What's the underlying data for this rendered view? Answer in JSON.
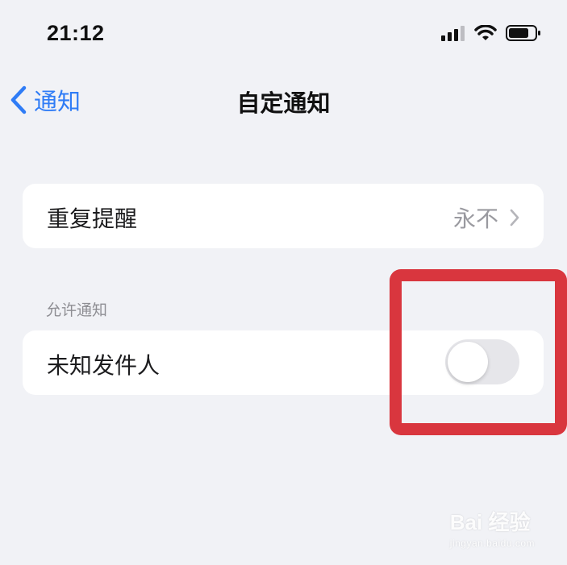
{
  "status_bar": {
    "time": "21:12",
    "icons": [
      "cellular-signal-icon",
      "wifi-icon",
      "battery-icon"
    ]
  },
  "nav": {
    "back_label": "通知",
    "title": "自定通知",
    "accent_color": "#2f7cf6"
  },
  "repeat_row": {
    "label": "重复提醒",
    "value": "永不"
  },
  "allow_section": {
    "header": "允许通知",
    "unknown_sender": {
      "label": "未知发件人",
      "enabled": false
    }
  },
  "annotation": {
    "color": "#d9363e"
  },
  "watermark": {
    "main": "Bai  经验",
    "sub": "jingyan.baidu.com"
  }
}
